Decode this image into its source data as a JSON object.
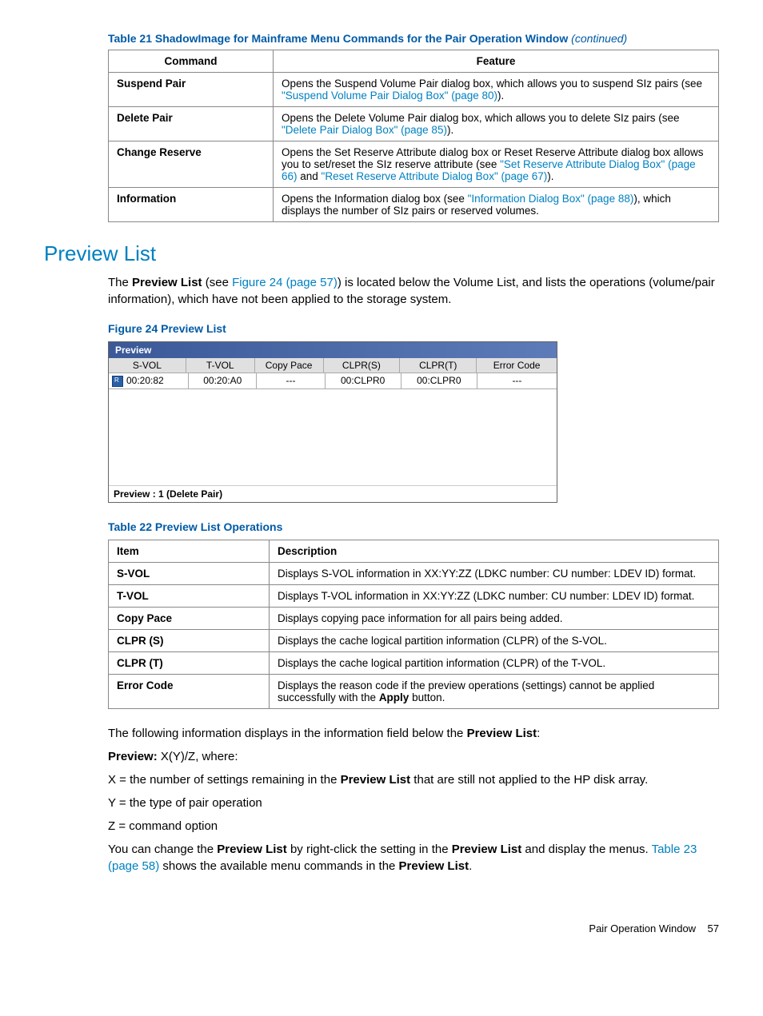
{
  "table21": {
    "caption": "Table 21 ShadowImage for Mainframe Menu Commands for the Pair Operation Window",
    "continued": "(continued)",
    "headers": [
      "Command",
      "Feature"
    ],
    "rows": [
      {
        "cmd": "Suspend Pair",
        "feature_pre": "Opens the Suspend Volume Pair dialog box, which allows you to suspend SIz pairs (see ",
        "link": "\"Suspend Volume Pair Dialog Box\" (page 80)",
        "feature_post": ")."
      },
      {
        "cmd": "Delete Pair",
        "feature_pre": "Opens the Delete Volume Pair dialog box, which allows you to delete SIz pairs (see ",
        "link": "\"Delete Pair Dialog Box\" (page 85)",
        "feature_post": ")."
      },
      {
        "cmd": "Change Reserve",
        "feature_pre": "Opens the Set Reserve Attribute dialog box or Reset Reserve Attribute dialog box allows you to set/reset the SIz reserve attribute (see ",
        "link": "\"Set Reserve Attribute Dialog Box\" (page 66)",
        "mid": " and ",
        "link2": "\"Reset Reserve Attribute Dialog Box\" (page 67)",
        "feature_post": ")."
      },
      {
        "cmd": "Information",
        "feature_pre": "Opens the Information dialog box (see ",
        "link": "\"Information Dialog Box\" (page 88)",
        "feature_post": "), which displays the number of SIz pairs or reserved volumes."
      }
    ]
  },
  "section_heading": "Preview List",
  "para1_pre": "The ",
  "para1_bold": "Preview List",
  "para1_mid1": " (see ",
  "para1_link": "Figure 24 (page 57)",
  "para1_post": ") is located below the Volume List, and lists the operations (volume/pair information), which have not been applied to the storage system.",
  "figure_caption": "Figure 24 Preview List",
  "preview": {
    "title": "Preview",
    "headers": [
      "S-VOL",
      "T-VOL",
      "Copy Pace",
      "CLPR(S)",
      "CLPR(T)",
      "Error Code"
    ],
    "row": [
      "00:20:82",
      "00:20:A0",
      "---",
      "00:CLPR0",
      "00:CLPR0",
      "---"
    ],
    "status": "Preview : 1 (Delete Pair)"
  },
  "table22": {
    "caption": "Table 22 Preview List Operations",
    "headers": [
      "Item",
      "Description"
    ],
    "rows": [
      {
        "item": "S-VOL",
        "desc": "Displays S-VOL information in XX:YY:ZZ (LDKC number: CU number: LDEV ID) format."
      },
      {
        "item": "T-VOL",
        "desc": "Displays T-VOL information in XX:YY:ZZ (LDKC number: CU number: LDEV ID) format."
      },
      {
        "item": "Copy Pace",
        "desc": "Displays copying pace information for all pairs being added."
      },
      {
        "item": "CLPR (S)",
        "desc": "Displays the cache logical partition information (CLPR) of the S-VOL."
      },
      {
        "item": "CLPR (T)",
        "desc": "Displays the cache logical partition information (CLPR) of the T-VOL."
      },
      {
        "item": "Error Code",
        "desc_pre": "Displays the reason code if the preview operations (settings) cannot be applied successfully with the ",
        "bold": "Apply",
        "desc_post": " button."
      }
    ]
  },
  "para2_pre": "The following information displays in the information field below the ",
  "para2_bold": "Preview List",
  "para2_post": ":",
  "para3_bold": "Preview:",
  "para3_text": " X(Y)/Z, where:",
  "para4_pre": "X = the number of settings remaining in the ",
  "para4_bold": "Preview List",
  "para4_post": " that are still not applied to the HP disk array.",
  "para5": "Y = the type of pair operation",
  "para6": "Z = command option",
  "para7_pre": "You can change the ",
  "para7_bold1": "Preview List",
  "para7_mid": " by right-click the setting in the ",
  "para7_bold2": "Preview List",
  "para7_post": " and display the menus. ",
  "para7_link": "Table 23 (page 58)",
  "para7_end_pre": " shows the available menu commands in the ",
  "para7_bold3": "Preview List",
  "para7_end_post": ".",
  "footer_text": "Pair Operation Window",
  "footer_page": "57"
}
